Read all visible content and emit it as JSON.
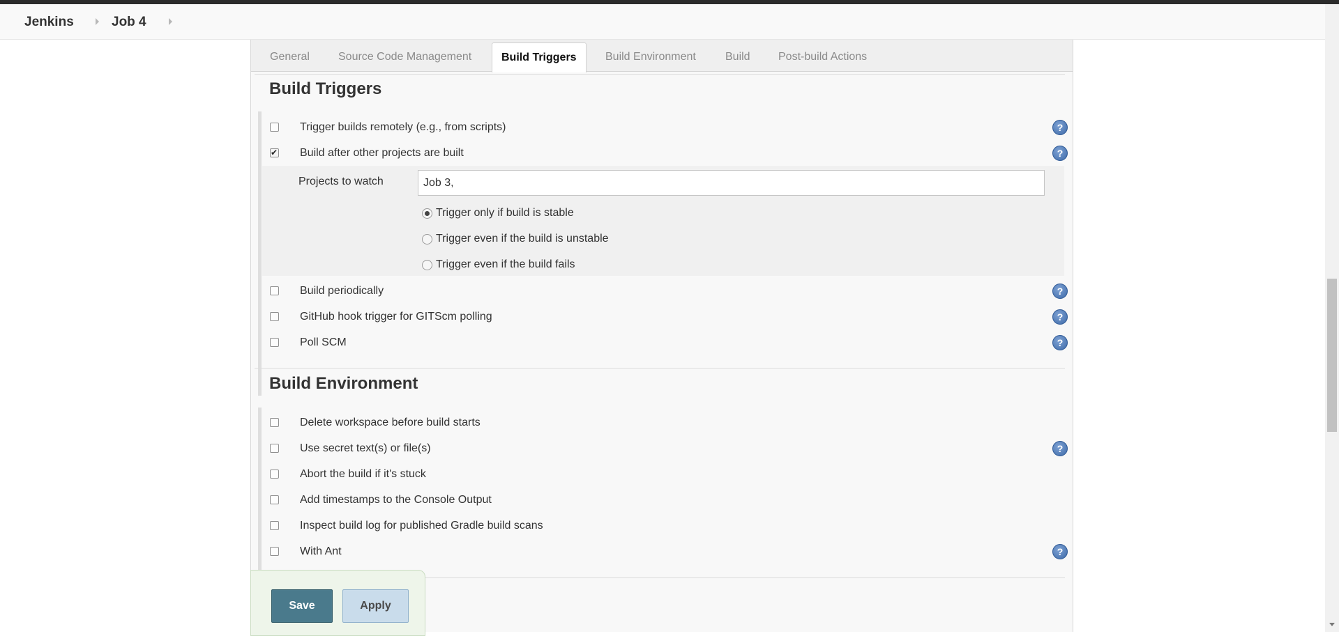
{
  "breadcrumb": {
    "items": [
      "Jenkins",
      "Job 4"
    ]
  },
  "tabs": [
    {
      "label": "General",
      "active": false
    },
    {
      "label": "Source Code Management",
      "active": false
    },
    {
      "label": "Build Triggers",
      "active": true
    },
    {
      "label": "Build Environment",
      "active": false
    },
    {
      "label": "Build",
      "active": false
    },
    {
      "label": "Post-build Actions",
      "active": false
    }
  ],
  "build_triggers": {
    "title": "Build Triggers",
    "options": [
      {
        "label": "Trigger builds remotely (e.g., from scripts)",
        "checked": false,
        "help": true
      },
      {
        "label": "Build after other projects are built",
        "checked": true,
        "help": true
      },
      {
        "label": "Build periodically",
        "checked": false,
        "help": true
      },
      {
        "label": "GitHub hook trigger for GITScm polling",
        "checked": false,
        "help": true
      },
      {
        "label": "Poll SCM",
        "checked": false,
        "help": true
      }
    ],
    "projects_to_watch": {
      "label": "Projects to watch",
      "value": "Job 3,",
      "radios": [
        {
          "label": "Trigger only if build is stable",
          "selected": true
        },
        {
          "label": "Trigger even if the build is unstable",
          "selected": false
        },
        {
          "label": "Trigger even if the build fails",
          "selected": false
        }
      ]
    }
  },
  "build_environment": {
    "title": "Build Environment",
    "options": [
      {
        "label": "Delete workspace before build starts",
        "checked": false,
        "help": false
      },
      {
        "label": "Use secret text(s) or file(s)",
        "checked": false,
        "help": true
      },
      {
        "label": "Abort the build if it's stuck",
        "checked": false,
        "help": false
      },
      {
        "label": "Add timestamps to the Console Output",
        "checked": false,
        "help": false
      },
      {
        "label": "Inspect build log for published Gradle build scans",
        "checked": false,
        "help": false
      },
      {
        "label": "With Ant",
        "checked": false,
        "help": true
      }
    ]
  },
  "icons": {
    "help": "help-question-icon",
    "check": "checkmark-icon",
    "chevron": "chevron-right-icon"
  },
  "help_glyph": "?",
  "check_glyph": "✔",
  "actions": {
    "save_label": "Save",
    "apply_label": "Apply"
  },
  "colors": {
    "save_bg": "#4a7a8c",
    "apply_bg": "#c9dceb",
    "help_icon": "#3e6aa8"
  }
}
